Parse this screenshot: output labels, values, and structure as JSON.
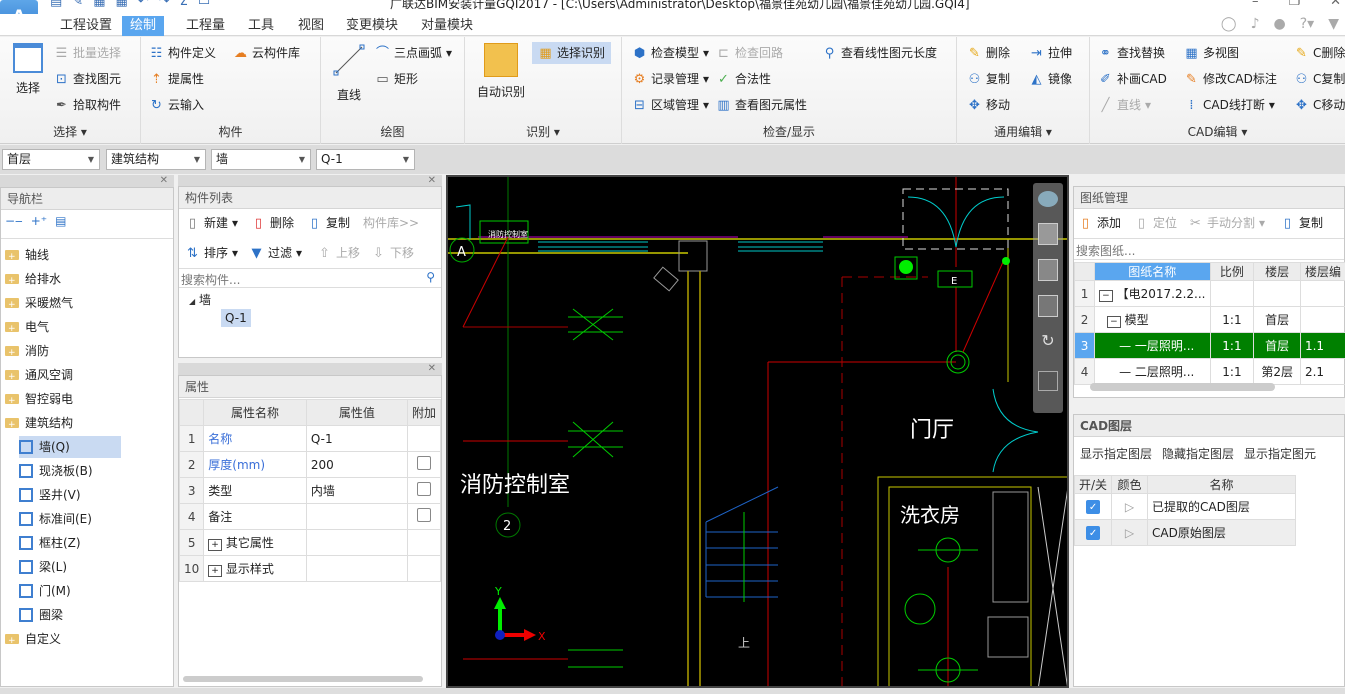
{
  "window": {
    "title": "广联达BIM安装计量GQI2017 - [C:\\Users\\Administrator\\Desktop\\福景佳苑幼儿园\\福景佳苑幼儿园.GQI4]",
    "logo_letter": "A",
    "controls": {
      "minimize": "–",
      "restore": "❐",
      "close": "✕"
    }
  },
  "menu": {
    "tabs": [
      "工程设置",
      "绘制",
      "工程量",
      "工具",
      "视图",
      "变更模块",
      "对量模块"
    ],
    "active": "绘制",
    "right_icons": [
      "user-icon",
      "bell-icon",
      "chat-icon",
      "help-icon",
      "shirt-icon"
    ]
  },
  "ribbon": {
    "select": {
      "label": "选择",
      "big": "选择",
      "items": [
        "批量选择",
        "查找图元",
        "拾取构件"
      ]
    },
    "component": {
      "label": "构件",
      "items": [
        "构件定义",
        "云构件库",
        "提属性",
        "云输入"
      ]
    },
    "draw": {
      "label": "绘图",
      "big": "直线",
      "items": [
        "三点画弧",
        "矩形"
      ]
    },
    "recognize": {
      "label": "识别",
      "big": "自动识别",
      "items": [
        "选择识别"
      ]
    },
    "check": {
      "label": "检查/显示",
      "items": [
        "检查模型",
        "检查回路",
        "查看线性图元长度",
        "记录管理",
        "合法性",
        "区域管理",
        "查看图元属性"
      ]
    },
    "edit": {
      "label": "通用编辑",
      "items": [
        "删除",
        "拉伸",
        "复制",
        "镜像",
        "移动"
      ]
    },
    "cad": {
      "label": "CAD编辑",
      "items": [
        "查找替换",
        "多视图",
        "C删除",
        "补画CAD",
        "修改CAD标注",
        "C复制",
        "直线",
        "CAD线打断",
        "C移动"
      ]
    }
  },
  "selectors": [
    "首层",
    "建筑结构",
    "墙",
    "Q-1"
  ],
  "nav": {
    "title": "导航栏",
    "categories": [
      "轴线",
      "给排水",
      "采暖燃气",
      "电气",
      "消防",
      "通风空调",
      "智控弱电",
      "建筑结构"
    ],
    "sub_items": [
      "墙(Q)",
      "现浇板(B)",
      "竖井(V)",
      "标准间(E)",
      "框柱(Z)",
      "梁(L)",
      "门(M)",
      "圈梁"
    ],
    "selected": "墙(Q)",
    "last": "自定义"
  },
  "complist": {
    "title": "构件列表",
    "toolbar1": [
      "新建",
      "删除",
      "复制",
      "构件库>>"
    ],
    "toolbar2": [
      "排序",
      "过滤",
      "上移",
      "下移"
    ],
    "search_placeholder": "搜索构件...",
    "tree_root": "墙",
    "tree_child": "Q-1"
  },
  "props": {
    "title": "属性",
    "headers": [
      "属性名称",
      "属性值",
      "附加"
    ],
    "rows": [
      {
        "n": "1",
        "name": "名称",
        "value": "Q-1",
        "blue": true,
        "check": false
      },
      {
        "n": "2",
        "name": "厚度(mm)",
        "value": "200",
        "blue": true,
        "check": true
      },
      {
        "n": "3",
        "name": "类型",
        "value": "内墙",
        "blue": false,
        "check": true
      },
      {
        "n": "4",
        "name": "备注",
        "value": "",
        "blue": false,
        "check": true
      },
      {
        "n": "5",
        "name": "其它属性",
        "value": "",
        "blue": false,
        "check": false,
        "expand": true
      },
      {
        "n": "10",
        "name": "显示样式",
        "value": "",
        "blue": false,
        "check": false,
        "expand": true
      }
    ]
  },
  "cad": {
    "labels": [
      "消防控制室",
      "门厅",
      "洗衣房",
      "消防控制室",
      "E",
      "A",
      "2",
      "上"
    ],
    "axis_x": "X",
    "axis_y": "Y"
  },
  "drawings": {
    "title": "图纸管理",
    "toolbar": [
      "添加",
      "定位",
      "手动分割",
      "复制"
    ],
    "search_placeholder": "搜索图纸...",
    "headers": [
      "图纸名称",
      "比例",
      "楼层",
      "楼层编"
    ],
    "rows": [
      {
        "n": "1",
        "name": "【电2017.2.2...",
        "scale": "",
        "floor": "",
        "code": ""
      },
      {
        "n": "2",
        "name": "模型",
        "scale": "1:1",
        "floor": "首层",
        "code": ""
      },
      {
        "n": "3",
        "name": "一层照明...",
        "scale": "1:1",
        "floor": "首层",
        "code": "1.1"
      },
      {
        "n": "4",
        "name": "二层照明...",
        "scale": "1:1",
        "floor": "第2层",
        "code": "2.1"
      }
    ],
    "selected_row": "3"
  },
  "layers": {
    "title": "CAD图层",
    "actions": [
      "显示指定图层",
      "隐藏指定图层",
      "显示指定图元"
    ],
    "headers": [
      "开/关",
      "颜色",
      "名称"
    ],
    "rows": [
      {
        "on": true,
        "name": "已提取的CAD图层"
      },
      {
        "on": true,
        "name": "CAD原始图层"
      }
    ]
  },
  "colors": {
    "accent": "#5aa6ef",
    "selected_row": "#008000",
    "select_bg": "#c9daf2"
  }
}
